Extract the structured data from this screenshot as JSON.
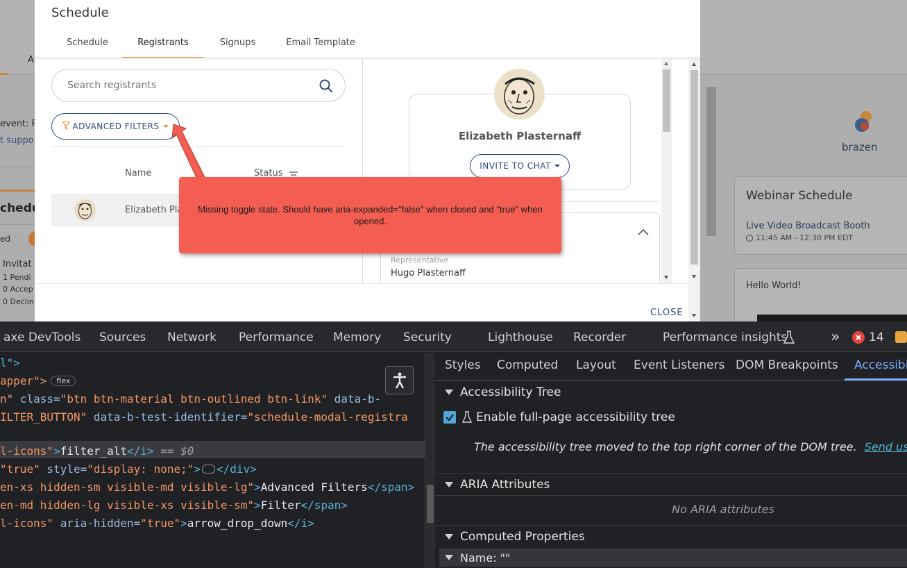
{
  "backdrop": {
    "fragments": {
      "a": "A",
      "event": "event: R",
      "support": "t suppor",
      "schedule": "chedu",
      "ed": "ed",
      "invitat": "Invitat",
      "pending": "1 Pendi",
      "accept": "0 Accep",
      "decline": "0 Declin"
    },
    "brand_name": "brazen",
    "webinar_card": {
      "title": "Webinar Schedule",
      "item": "Live Video Broadcast Booth",
      "time": "11:45 AM - 12:30 PM EDT"
    },
    "hello_card": {
      "text": "Hello World!"
    }
  },
  "modal": {
    "title": "Schedule",
    "tabs": [
      {
        "label": "Schedule"
      },
      {
        "label": "Registrants"
      },
      {
        "label": "Signups"
      },
      {
        "label": "Email Template"
      }
    ],
    "search": {
      "placeholder": "Search registrants"
    },
    "advanced_filters_label": "ADVANCED FILTERS",
    "table": {
      "col_name": "Name",
      "col_status": "Status",
      "row_name": "Elizabeth Pla"
    },
    "profile": {
      "name": "Elizabeth Plasternaff",
      "invite_label": "INVITE TO CHAT",
      "rep_label": "Representative",
      "rep_name": "Hugo Plasternaff"
    },
    "close_label": "CLOSE"
  },
  "callout": {
    "text": "Missing toggle state. Should have aria-expanded=\"false\" when closed and \"true\" when opened."
  },
  "devtools": {
    "tabs": [
      "axe DevTools",
      "Sources",
      "Network",
      "Performance",
      "Memory",
      "Security",
      "Lighthouse",
      "Recorder",
      "Performance insights"
    ],
    "more_glyph": "»",
    "error_count": "14",
    "code": {
      "l1": "l\">",
      "l2a": "apper\">",
      "l2_badge": "flex",
      "l3a": "n\" ",
      "l3_attr": "class=",
      "l3_val": "\"btn btn-material btn-outlined btn-link\"",
      "l3_attr2": " data-b-",
      "l4_val": "ILTER_BUTTON\"",
      "l4_attr": " data-b-test-identifier=",
      "l4_val2": "\"schedule-modal-registra",
      "l5_val": "l-icons\"",
      "l5_tag": ">",
      "l5_txt": "filter_alt",
      "l5_close": "</i>",
      "l5_dim": " == $0",
      "l6_val": "\"true\"",
      "l6_attr": " style=",
      "l6_val2": "\"display: none;\"",
      "l6_tag": ">",
      "l6_close": "</div>",
      "l7_val": "en-xs hidden-sm visible-md visible-lg\"",
      "l7_tag": ">",
      "l7_txt": "Advanced Filters",
      "l7_close": "</span>",
      "l8_val": "en-md hidden-lg visible-xs visible-sm\"",
      "l8_tag": ">",
      "l8_txt": "Filter",
      "l8_close": "</span>",
      "l9_val": "l-icons\"",
      "l9_attr": " aria-hidden=",
      "l9_val2": "\"true\"",
      "l9_tag": ">",
      "l9_txt": "arrow_drop_down",
      "l9_close": "</i>"
    },
    "side_tabs": [
      "Styles",
      "Computed",
      "Layout",
      "Event Listeners",
      "DOM Breakpoints",
      "Accessibil"
    ],
    "accessibility_tree": {
      "heading": "Accessibility Tree",
      "checkbox_label": "Enable full-page accessibility tree",
      "note": "The accessibility tree moved to the top right corner of the DOM tree.",
      "link": "Send us you"
    },
    "aria": {
      "heading": "ARIA Attributes",
      "empty": "No ARIA attributes"
    },
    "computed": {
      "heading": "Computed Properties",
      "name_row": "Name: \"\""
    }
  },
  "colors": {
    "accent_orange": "#f0913a",
    "navy": "#2c4a86",
    "callout": "#f45e52",
    "devtools_bg": "#202124",
    "devtools_link": "#4fb3d6"
  }
}
